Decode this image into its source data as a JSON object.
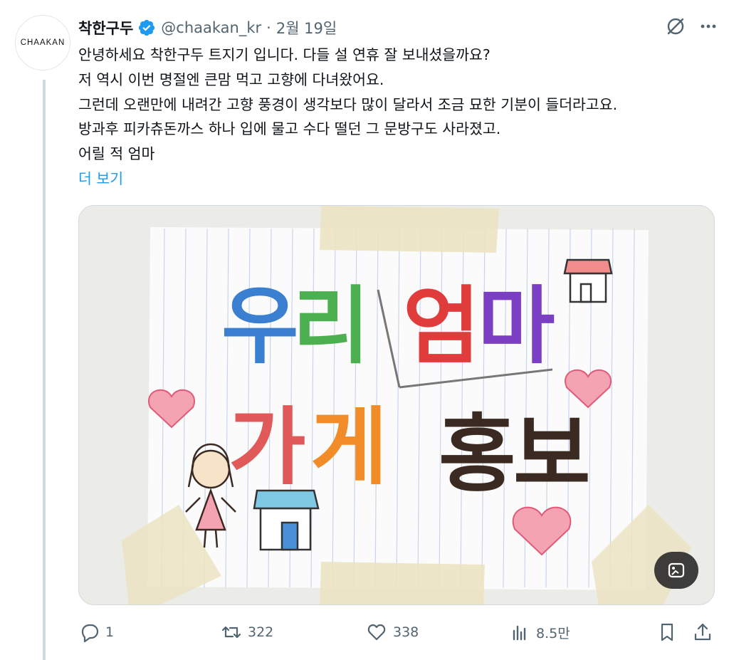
{
  "author": {
    "avatar_text": "CHAAKAN",
    "name": "착한구두",
    "handle": "@chaakan_kr",
    "separator": "·",
    "date": "2월 19일",
    "verified_icon": "verified-badge-icon"
  },
  "tweet": {
    "lines": [
      "안녕하세요 착한구두 트지기 입니다. 다들 설 연휴 잘 보내셨을까요?",
      "저 역시 이번 명절엔 큰맘 먹고 고향에 다녀왔어요.",
      "그런데 오랜만에 내려간 고향 풍경이 생각보다 많이 달라서 조금 묘한 기분이 들더라고요.",
      "방과후 피카츄돈까스 하나 입에 물고 수다 떨던 그 문방구도 사라졌고.",
      "어릴 적 엄마"
    ],
    "show_more": "더 보기"
  },
  "media": {
    "drawing_text_line1": [
      "우",
      "리",
      "엄",
      "마"
    ],
    "drawing_text_line2": [
      "가",
      "게",
      "홍",
      "보"
    ],
    "drawing_colors": [
      "#3a7fd0",
      "#4caf50",
      "#e03c3c",
      "#7b3fc4",
      "#e05a5a",
      "#f28c28",
      "#3b2a22"
    ]
  },
  "actions": {
    "reply": "1",
    "retweet": "322",
    "like": "338",
    "views": "8.5만"
  },
  "colors": {
    "accent": "#1d9bf0",
    "muted": "#536471"
  }
}
